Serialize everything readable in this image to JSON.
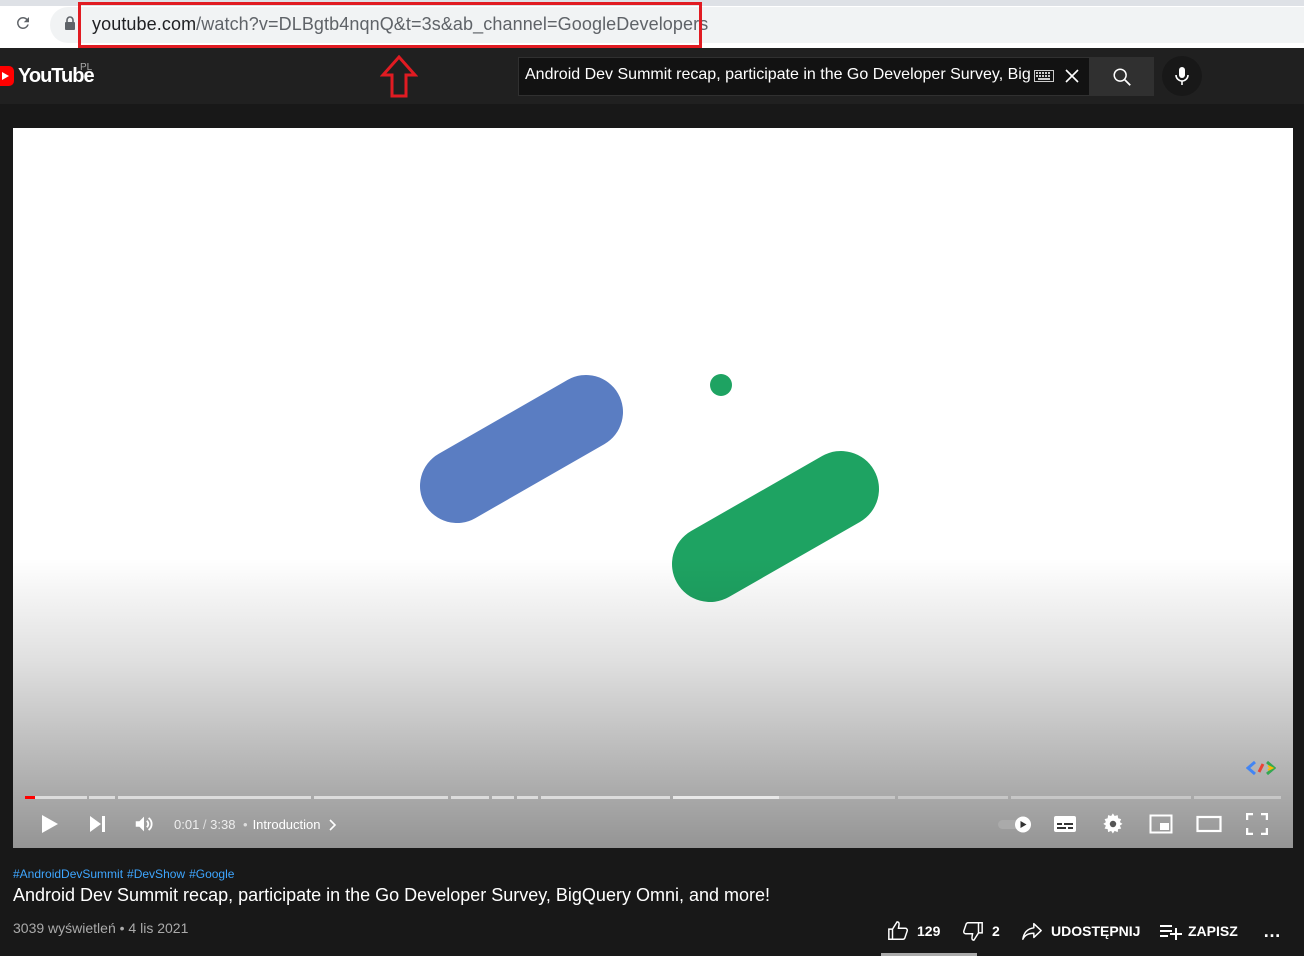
{
  "browser": {
    "url_host": "youtube.com",
    "url_rest": "/watch?v=DLBgtb4nqnQ&t=3s&ab_channel=GoogleDevelopers",
    "annotation_color": "#e11b22"
  },
  "masthead": {
    "logo_text": "YouTube",
    "region": "PL",
    "search_query": "Android Dev Summit recap, participate in the Go Developer Survey, BigQ"
  },
  "player": {
    "current_time": "0:01",
    "separator": " / ",
    "duration": "3:38",
    "chapter_dot": "•",
    "chapter_label": "Introduction",
    "played_fraction": 0.008,
    "buffered_fraction": 0.6
  },
  "video": {
    "hashtags": [
      "#AndroidDevSummit",
      "#DevShow",
      "#Google"
    ],
    "title": "Android Dev Summit recap, participate in the Go Developer Survey, BigQuery Omni, and more!",
    "views": "3039 wyświetleń",
    "meta_dot": " • ",
    "date": "4 lis 2021",
    "likes": "129",
    "dislikes": "2",
    "share_label": "UDOSTĘPNIJ",
    "save_label": "ZAPISZ",
    "more_label": "…"
  },
  "colors": {
    "accent_red": "#ff0000",
    "link_blue": "#3ea6ff",
    "shape_blue": "#5a7dc2",
    "shape_green": "#1ea362"
  }
}
